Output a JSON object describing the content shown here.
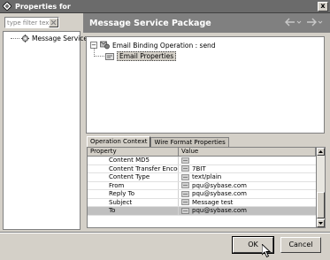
{
  "window": {
    "title": "Properties for",
    "close_label": "x"
  },
  "filter": {
    "placeholder": "type filter text"
  },
  "nav": {
    "items": [
      {
        "label": "Message Service",
        "icon": "gear-icon"
      }
    ]
  },
  "header": {
    "title": "Message Service Package",
    "back_icon": "back-arrow-icon",
    "forward_icon": "forward-arrow-icon"
  },
  "tree": {
    "root": {
      "label": "Email Binding Operation : send",
      "expander": "−",
      "icon": "binding-operation-icon"
    },
    "child": {
      "label": "Email Properties",
      "icon": "properties-icon"
    }
  },
  "tabs": [
    {
      "label": "Operation Context",
      "active": true
    },
    {
      "label": "Wire Format Properties",
      "active": false
    }
  ],
  "table": {
    "columns": [
      "Property",
      "Value"
    ],
    "rows": [
      {
        "property": "Content MD5",
        "value": ""
      },
      {
        "property": "Content Transfer Encodin",
        "value": "7BIT"
      },
      {
        "property": "Content Type",
        "value": "text/plain"
      },
      {
        "property": "From",
        "value": "pqu@sybase.com"
      },
      {
        "property": "Reply To",
        "value": "pqu@sybase.com"
      },
      {
        "property": "Subject",
        "value": "Message test"
      },
      {
        "property": "To",
        "value": "pqu@sybase.com"
      }
    ],
    "selected_row": 6
  },
  "buttons": {
    "ok": "OK",
    "cancel": "Cancel"
  },
  "colors": {
    "titlebar": "#6b6b6b",
    "header": "#808080",
    "chrome": "#d4d0c8"
  }
}
